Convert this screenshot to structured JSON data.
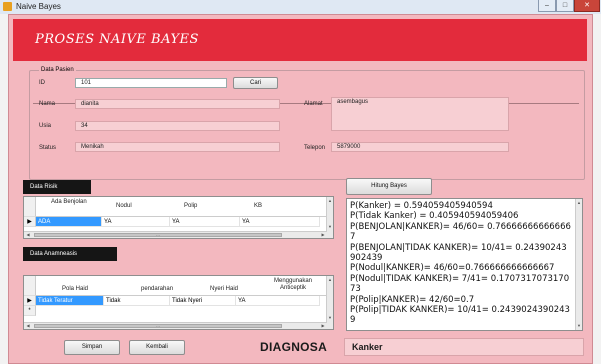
{
  "window": {
    "title": "Naive Bayes"
  },
  "header": {
    "title": "PROSES NAIVE BAYES"
  },
  "data_pasien": {
    "group_label": "Data Pasien",
    "id_label": "ID",
    "id_value": "101",
    "cari_label": "Cari",
    "nama_label": "Nama",
    "nama_value": "dianita",
    "usia_label": "Usia",
    "usia_value": "34",
    "status_label": "Status",
    "status_value": "Menikah",
    "alamat_label": "Alamat",
    "alamat_value": "asembagus",
    "telepon_label": "Telepon",
    "telepon_value": "5879000"
  },
  "data_risik": {
    "label": "Data Risik",
    "columns": [
      "Ada Benjolan",
      "Nodul",
      "Polip",
      "KB"
    ],
    "rows": [
      [
        "ADA",
        "YA",
        "YA",
        "YA"
      ]
    ]
  },
  "data_anamneasis": {
    "label": "Data Anamneasis",
    "columns": [
      "Pola Haid",
      "pendarahan",
      "Nyeri Haid",
      "Menggunakan Anticeptik"
    ],
    "rows": [
      [
        "Tidak Teratur",
        "Tidak",
        "Tidak Nyeri",
        "YA"
      ]
    ],
    "new_row_marker": "*"
  },
  "hitung_button": "Hitung Bayes",
  "result_text": "P(Kanker) = 0.594059405940594\nP(Tidak Kanker) = 0.405940594059406\nP(BENJOLAN|KANKER)= 46/60= 0.766666666666667\nP(BENJOLAN|TIDAK KANKER)= 10/41= 0.24390243902439\nP(Nodul|KANKER)= 46/60=0.766666666666667\nP(Nodul|TIDAK KANKER)= 7/41= 0.170731707317073\nP(Polip|KANKER)= 42/60=0.7\nP(Polip|TIDAK KANKER)= 10/41= 0.24390243902439",
  "diagnosa": {
    "label": "DIAGNOSA",
    "value": "Kanker"
  },
  "buttons": {
    "simpan": "Simpan",
    "kembali": "Kembali"
  }
}
